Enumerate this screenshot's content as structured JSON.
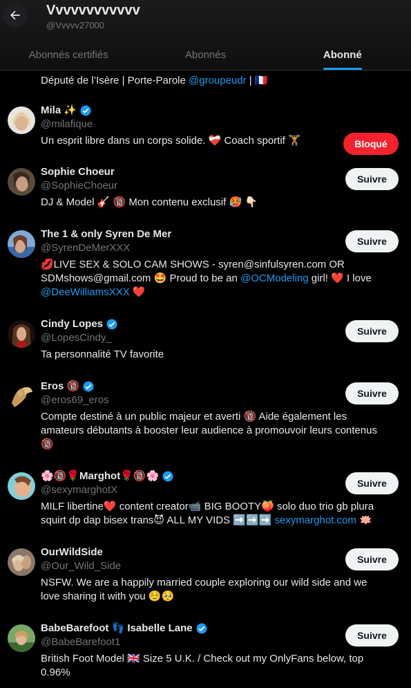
{
  "header": {
    "title": "Vvvvvvvvvvvv",
    "handle": "@Vvvvv27000"
  },
  "tabs": [
    {
      "label": "Abonnés certifiés"
    },
    {
      "label": "Abonnés"
    },
    {
      "label": "Abonné"
    }
  ],
  "partial_bio": {
    "text": "Député de l’Isère | Porte-Parole ",
    "link": "@groupeudr",
    "tail": " | 🇫🇷"
  },
  "users": [
    {
      "name": "Mila ✨",
      "handle": "@milafique",
      "button": "Bloqué",
      "bio": [
        "Un esprit libre dans un corps solide. ❤️‍🩹 Coach sportif 🏋️"
      ]
    },
    {
      "name": "Sophie Choeur",
      "handle": "@SophieChoeur",
      "button": "Suivre",
      "bio": [
        "DJ & Model 🎸 🔞 Mon contenu exclusif 🥵 👇🏻"
      ]
    },
    {
      "name": "The 1 & only Syren De Mer",
      "handle": "@SyrenDeMerXXX",
      "button": "Suivre",
      "bio_pre": "💋LIVE SEX & SOLO CAM SHOWS - syren@sinfulsyren.com OR SDMshows@gmail.com 🤩 Proud to be an ",
      "bio_link1": "@OCModeling",
      "bio_mid": " girl! ❤️ I love ",
      "bio_link2": "@DeeWilliamsXXX",
      "bio_end": " ❤️"
    },
    {
      "name": "Cindy Lopes",
      "handle": "@LopesCindy_",
      "button": "Suivre",
      "bio": [
        "Ta personnalité TV favorite"
      ]
    },
    {
      "name": "Eros 🔞",
      "handle": "@eros69_eros",
      "button": "Suivre",
      "bio": [
        "Compte destiné à un public majeur et averti 🔞 Aide également les amateurs débutants à booster leur audience à promouvoir leurs contenus 🔞"
      ]
    },
    {
      "name": "🌸🔞🌹Marghot🌹🔞🌸",
      "handle": "@sexymarghotX",
      "button": "Suivre",
      "bio_pre": "MILF libertine❤️ content creator📹 BIG BOOTY🍑 solo duo trio gb plura squirt dp dap bisex trans😈 ALL MY VIDS ➡️➡️➡️ ",
      "bio_link1": "sexymarghot.com",
      "bio_end": " 🪷"
    },
    {
      "name": "OurWildSide",
      "handle": "@Our_Wild_Side",
      "button": "Suivre",
      "bio": [
        "NSFW. We are a happily married couple exploring our wild side and we love sharing it with you ☺️🥺"
      ]
    },
    {
      "name": "BabeBarefoot 👣 Isabelle Lane",
      "handle": "@BabeBarefoot1",
      "button": "Suivre",
      "bio": [
        "British Foot Model 🇬🇧 Size 5 U.K. / Check out my OnlyFans below, top 0.96%"
      ]
    }
  ],
  "colors": {
    "accent": "#1d9bf0",
    "blocked": "#f4212e",
    "background": "#000000",
    "muted": "#71767b"
  }
}
